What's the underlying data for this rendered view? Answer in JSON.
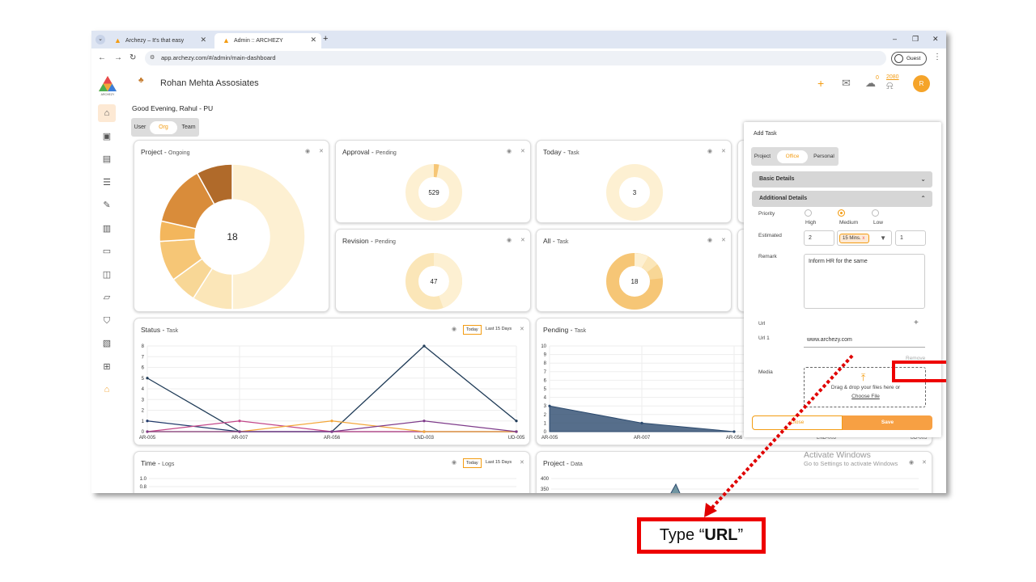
{
  "browser": {
    "tabs": [
      {
        "label": "Archezy – It's that easy"
      },
      {
        "label": "Admin :: ARCHEZY"
      }
    ],
    "url": "app.archezy.com/#/admin/main-dashboard",
    "profile": "Guest"
  },
  "app": {
    "org_name": "Rohan Mehta Assosiates",
    "bubble_count": "0",
    "bell_count": "2080",
    "avatar_initial": "R",
    "greeting": "Good Evening, Rahul - PU",
    "view_tabs": [
      "User",
      "Org",
      "Team"
    ]
  },
  "cards": {
    "project": {
      "title": "Project",
      "sub": "Ongoing",
      "value": "18"
    },
    "approval": {
      "title": "Approval",
      "sub": "Pending",
      "value": "529"
    },
    "today": {
      "title": "Today",
      "sub": "Task",
      "value": "3"
    },
    "revision": {
      "title": "Revision",
      "sub": "Pending",
      "value": "47"
    },
    "all": {
      "title": "All",
      "sub": "Task",
      "value": "18"
    },
    "status": {
      "title": "Status",
      "sub": "Task",
      "filters": [
        "Today",
        "Last 15 Days"
      ]
    },
    "pending": {
      "title": "Pending",
      "sub": "Task"
    },
    "time": {
      "title": "Time",
      "sub": "Logs",
      "filters": [
        "Today",
        "Last 15 Days"
      ]
    },
    "project_data": {
      "title": "Project",
      "sub": "Data"
    }
  },
  "chart_data": [
    {
      "type": "line",
      "categories": [
        "AR-005",
        "AR-007",
        "AR-056",
        "LND-003",
        "UD-005"
      ],
      "y_ticks": [
        "0",
        "1",
        "2",
        "3",
        "4",
        "5",
        "6",
        "7",
        "8"
      ],
      "ylim": [
        0,
        8
      ],
      "series": [
        {
          "color": "#1f3b57",
          "values": [
            5,
            0,
            0,
            8,
            1
          ]
        },
        {
          "color": "#223a6b",
          "values": [
            1,
            0,
            0,
            0,
            0
          ]
        },
        {
          "color": "#c2478a",
          "values": [
            0,
            1,
            0,
            0,
            0
          ]
        },
        {
          "color": "#f3a73a",
          "values": [
            0,
            0,
            1,
            0,
            0
          ]
        },
        {
          "color": "#7e3b8a",
          "values": [
            0,
            0,
            0,
            1,
            0
          ]
        }
      ]
    },
    {
      "type": "area",
      "categories": [
        "AR-005",
        "AR-007",
        "AR-056",
        "LND-003",
        "UD-005"
      ],
      "y_ticks": [
        "0",
        "1",
        "2",
        "3",
        "4",
        "5",
        "6",
        "7",
        "8",
        "9",
        "10"
      ],
      "ylim": [
        0,
        10
      ],
      "series": [
        {
          "color": "#2c4a6e",
          "values": [
            3,
            1,
            0,
            null,
            null
          ]
        }
      ]
    },
    {
      "type": "line",
      "y_ticks": [
        "0.8",
        "1.0"
      ]
    },
    {
      "type": "area",
      "y_ticks": [
        "350",
        "400"
      ]
    }
  ],
  "panel": {
    "title": "Add Task",
    "type_tabs": [
      "Project",
      "Office",
      "Personal"
    ],
    "basic": "Basic Details",
    "additional": "Additional Details",
    "priority_label": "Priority",
    "priorities": [
      "High",
      "Medium",
      "Low"
    ],
    "estimated_label": "Estimated",
    "estimated_value": "2",
    "estimated_unit": "15 Mins.",
    "estimated_count": "1",
    "remark_label": "Remark",
    "remark_value": "Inform HR for the same",
    "url_label": "Url",
    "url1_label": "Url 1",
    "url1_value": "www.archezy.com",
    "remove": "Remove",
    "media_label": "Media",
    "media_text": "Drag & drop your files here or",
    "choose_file": "Choose File",
    "close": "Close",
    "save": "Save"
  },
  "watermark": {
    "line1": "Activate Windows",
    "line2": "Go to Settings to activate Windows"
  },
  "annotation": {
    "prefix": "Type “",
    "bold": "URL",
    "suffix": "”"
  }
}
